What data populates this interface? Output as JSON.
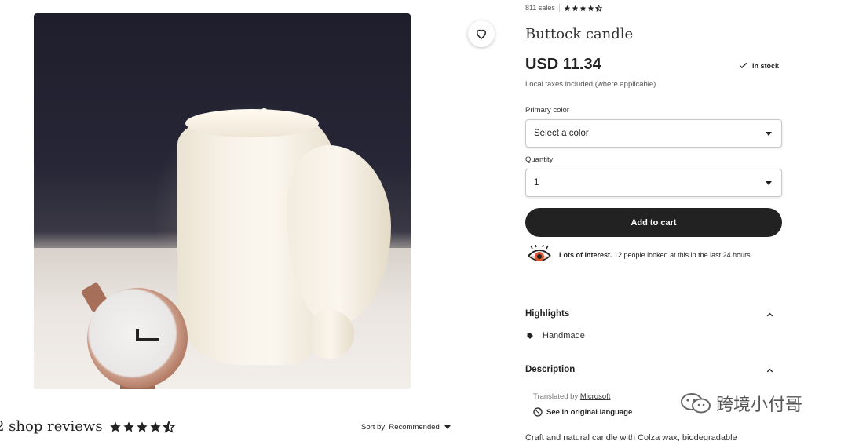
{
  "listing": {
    "sales": "811 sales",
    "rating": 4.5,
    "title": "Buttock candle",
    "price": "USD 11.34",
    "stock": "In stock",
    "taxes": "Local taxes included (where applicable)"
  },
  "options": {
    "color_label": "Primary color",
    "color_value": "Select a color",
    "quantity_label": "Quantity",
    "quantity_value": "1"
  },
  "cart": {
    "button_label": "Add to cart"
  },
  "interest": {
    "bold": "Lots of interest.",
    "text": "12 people looked at this in the last 24 hours."
  },
  "highlights": {
    "heading": "Highlights",
    "item": "Handmade"
  },
  "description": {
    "heading": "Description",
    "translated_prefix": "Translated by",
    "translator": "Microsoft",
    "original_link": "See in original language",
    "text": "Craft and natural candle with Colza wax, biodegradable"
  },
  "reviews": {
    "count_text": "2 shop reviews",
    "rating": 4.5,
    "sort_label": "Sort by: Recommended"
  },
  "watermark": {
    "text": "跨境小付哥"
  },
  "colors": {
    "dark": "#222222",
    "star": "#222222"
  }
}
